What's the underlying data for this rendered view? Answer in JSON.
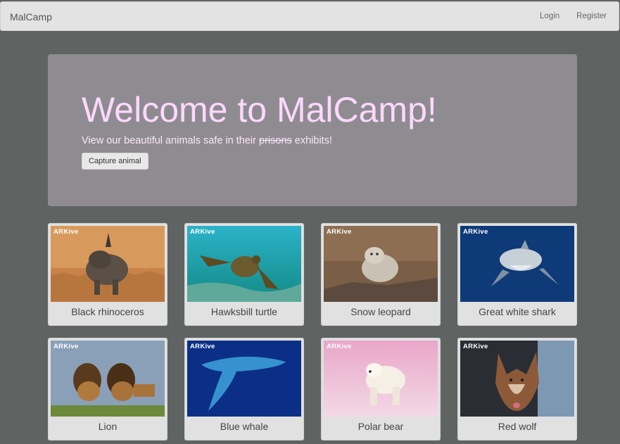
{
  "navbar": {
    "brand": "MalCamp",
    "login": "Login",
    "register": "Register"
  },
  "hero": {
    "title": "Welcome to MalCamp!",
    "tagline_before": "View our beautiful animals safe in their ",
    "tagline_struck": "prisons",
    "tagline_after": " exhibits!",
    "button": "Capture animal"
  },
  "watermark": "ARKive",
  "animals": [
    {
      "name": "Black rhinoceros"
    },
    {
      "name": "Hawksbill turtle"
    },
    {
      "name": "Snow leopard"
    },
    {
      "name": "Great white shark"
    },
    {
      "name": "Lion"
    },
    {
      "name": "Blue whale"
    },
    {
      "name": "Polar bear"
    },
    {
      "name": "Red wolf"
    }
  ]
}
